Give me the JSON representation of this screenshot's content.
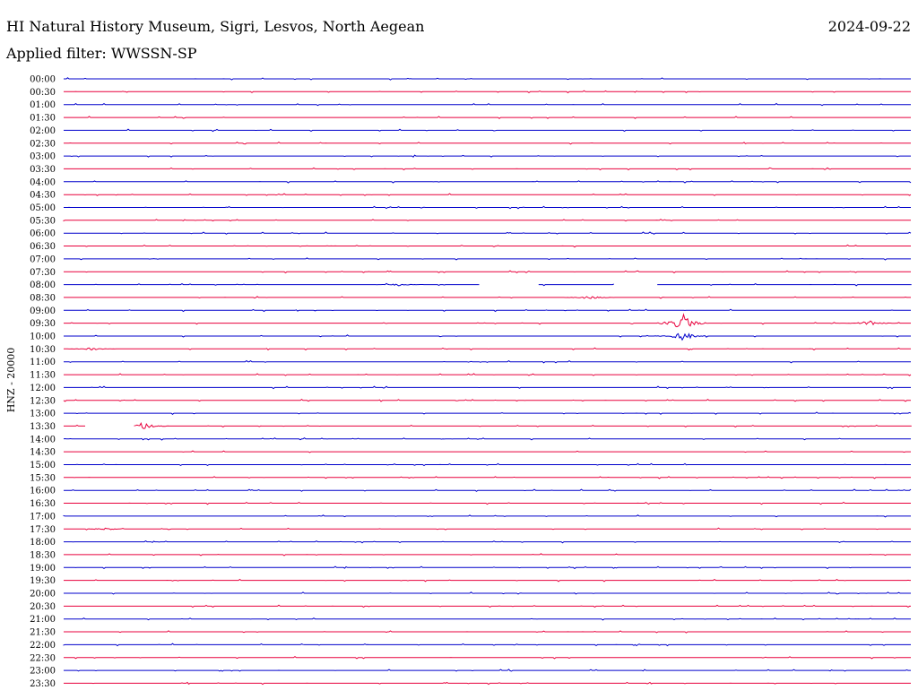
{
  "header": {
    "station": "HI Natural History Museum, Sigri, Lesvos, North Aegean",
    "date": "2024-09-22",
    "filter_label": "Applied filter:",
    "filter_value": "WWSSN-SP"
  },
  "chart_data": {
    "type": "line",
    "title": "HI Natural History Museum, Sigri, Lesvos, North Aegean",
    "ylabel": "HNZ - 20000",
    "traces": [
      "00:00",
      "00:30",
      "01:00",
      "01:30",
      "02:00",
      "02:30",
      "03:00",
      "03:30",
      "04:00",
      "04:30",
      "05:00",
      "05:30",
      "06:00",
      "06:30",
      "07:00",
      "07:30",
      "08:00",
      "08:30",
      "09:00",
      "09:30",
      "10:00",
      "10:30",
      "11:00",
      "11:30",
      "12:00",
      "12:30",
      "13:00",
      "13:30",
      "14:00",
      "14:30",
      "15:00",
      "15:30",
      "16:00",
      "16:30",
      "17:00",
      "17:30",
      "18:00",
      "18:30",
      "19:00",
      "19:30",
      "20:00",
      "20:30",
      "21:00",
      "21:30",
      "22:00",
      "22:30",
      "23:00",
      "23:30"
    ],
    "x_range_minutes": [
      0,
      30
    ],
    "trace_colors": [
      "#0000cc",
      "#e8003c"
    ],
    "data_gaps": [
      {
        "trace": "08:00",
        "start_min": 14.7,
        "end_min": 16.8
      },
      {
        "trace": "08:00",
        "start_min": 19.5,
        "end_min": 21.0
      },
      {
        "trace": "13:30",
        "start_min": 0.8,
        "end_min": 2.5
      }
    ],
    "events": [
      {
        "trace": "09:30",
        "time_min": 21.9,
        "amplitude": 12
      },
      {
        "trace": "09:30",
        "time_min": 28.5,
        "amplitude": 3
      },
      {
        "trace": "10:00",
        "time_min": 21.9,
        "amplitude": 5
      },
      {
        "trace": "13:30",
        "time_min": 2.8,
        "amplitude": 4
      },
      {
        "trace": "08:30",
        "time_min": 18.6,
        "amplitude": 2
      },
      {
        "trace": "17:30",
        "time_min": 1.5,
        "amplitude": 1.5
      },
      {
        "trace": "08:00",
        "time_min": 11.9,
        "amplitude": 1.5
      },
      {
        "trace": "10:30",
        "time_min": 1.0,
        "amplitude": 1.5
      }
    ]
  }
}
